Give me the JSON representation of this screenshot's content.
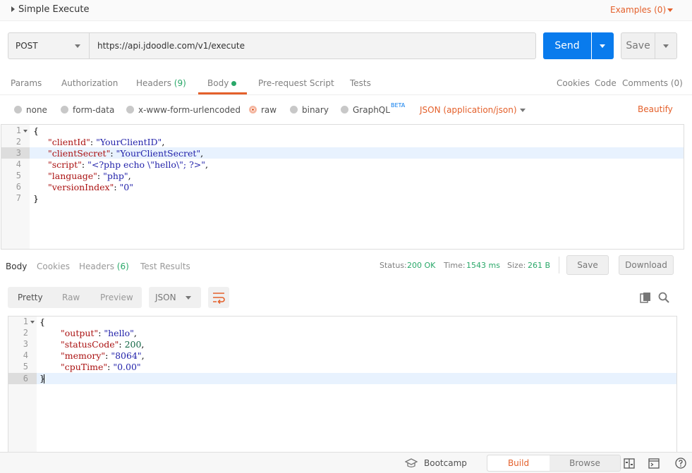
{
  "collection": {
    "title": "Simple Execute",
    "examples_label": "Examples (0)"
  },
  "request": {
    "method": "POST",
    "url": "https://api.jdoodle.com/v1/execute",
    "send_label": "Send",
    "save_label": "Save"
  },
  "tabs": {
    "params": "Params",
    "authorization": "Authorization",
    "headers": "Headers",
    "headers_count": "(9)",
    "body": "Body",
    "prerequest": "Pre-request Script",
    "tests": "Tests",
    "cookies": "Cookies",
    "code": "Code",
    "comments": "Comments (0)"
  },
  "body_modes": {
    "none": "none",
    "form_data": "form-data",
    "urlencoded": "x-www-form-urlencoded",
    "raw": "raw",
    "binary": "binary",
    "graphql": "GraphQL",
    "beta": "BETA",
    "content_type": "JSON (application/json)",
    "beautify": "Beautify",
    "selected": "raw"
  },
  "request_body": {
    "line_numbers": [
      "1",
      "2",
      "3",
      "4",
      "5",
      "6",
      "7"
    ],
    "lines": {
      "l1": "{",
      "client_id_key": "\"clientId\"",
      "client_id_val": "\"YourClientID\"",
      "client_secret_key": "\"clientSecret\"",
      "client_secret_val": "\"YourClientSecret\"",
      "script_key": "\"script\"",
      "script_val": "\"<?php echo \\\"hello\\\"; ?>\"",
      "language_key": "\"language\"",
      "language_val": "\"php\"",
      "version_key": "\"versionIndex\"",
      "version_val": "\"0\"",
      "l7": "}"
    }
  },
  "response": {
    "tabs": {
      "body": "Body",
      "cookies": "Cookies",
      "headers": "Headers",
      "headers_count": "(6)",
      "test_results": "Test Results"
    },
    "status_label": "Status:",
    "status_value": "200 OK",
    "time_label": "Time:",
    "time_value": "1543 ms",
    "size_label": "Size:",
    "size_value": "261 B",
    "save_label": "Save",
    "download_label": "Download",
    "views": {
      "pretty": "Pretty",
      "raw": "Raw",
      "preview": "Preview"
    },
    "format": "JSON",
    "line_numbers": [
      "1",
      "2",
      "3",
      "4",
      "5",
      "6"
    ],
    "lines": {
      "l1": "{",
      "output_key": "\"output\"",
      "output_val": "\"hello\"",
      "status_key": "\"statusCode\"",
      "status_val": "200",
      "memory_key": "\"memory\"",
      "memory_val": "\"8064\"",
      "cpu_key": "\"cpuTime\"",
      "cpu_val": "\"0.00\"",
      "l6": "}"
    }
  },
  "bottom_bar": {
    "bootcamp": "Bootcamp",
    "build": "Build",
    "browse": "Browse"
  },
  "colors": {
    "accent": "#e4602b",
    "primary": "#097bed",
    "success": "#2aa869"
  },
  "icons": [
    "caret-right-icon",
    "chevron-down-icon",
    "wrap-lines-icon",
    "copy-icon",
    "search-icon",
    "bootcamp-icon",
    "two-pane-icon",
    "console-icon",
    "help-icon"
  ]
}
